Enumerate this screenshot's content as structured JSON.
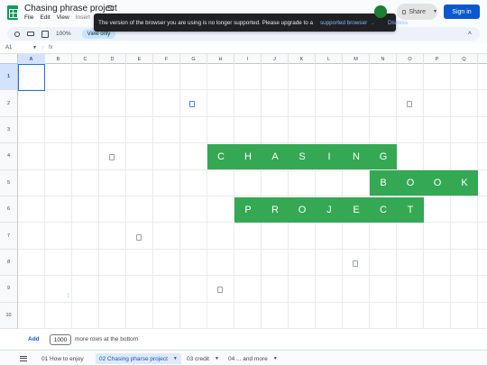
{
  "doc": {
    "title": "Chasing phrase project",
    "menu": [
      "File",
      "Edit",
      "View",
      "Insert"
    ]
  },
  "banner": {
    "message": "The version of the browser you are using is no longer supported. Please upgrade to a",
    "link": "supported browser",
    "dot": ".",
    "dismiss": "Dismiss"
  },
  "header": {
    "share_label": "Share",
    "signin_label": "Sign in"
  },
  "toolbar": {
    "zoom": "100%",
    "view_only": "View only"
  },
  "formula_bar": {
    "cell_ref": "A1"
  },
  "columns": [
    "A",
    "B",
    "C",
    "D",
    "E",
    "F",
    "G",
    "H",
    "I",
    "J",
    "K",
    "L",
    "M",
    "N",
    "O",
    "P",
    "Q"
  ],
  "rows": [
    "1",
    "2",
    "3",
    "4",
    "5",
    "6",
    "7",
    "8",
    "9",
    "10"
  ],
  "selected_cell": "A1",
  "phrase_rows": [
    {
      "row": 4,
      "letters": [
        "C",
        "H",
        "A",
        "S",
        "I",
        "N",
        "G"
      ]
    },
    {
      "row": 5,
      "letters": [
        "B",
        "O",
        "O",
        "K"
      ]
    },
    {
      "row": 6,
      "letters": [
        "P",
        "R",
        "O",
        "J",
        "E",
        "C",
        "T"
      ]
    }
  ],
  "add_rows": {
    "add_label": "Add",
    "count": "1000",
    "suffix": "more rows at the bottom"
  },
  "sheets": [
    {
      "label": "01 How to enjoy",
      "active": false
    },
    {
      "label": "02 Chasing pharse project",
      "active": true
    },
    {
      "label": "03 credit",
      "active": false
    },
    {
      "label": "04 ... and more",
      "active": false
    }
  ],
  "colors": {
    "accent": "#0b57d0",
    "banner_bg": "#202124",
    "phrase_green": "#34a853"
  }
}
